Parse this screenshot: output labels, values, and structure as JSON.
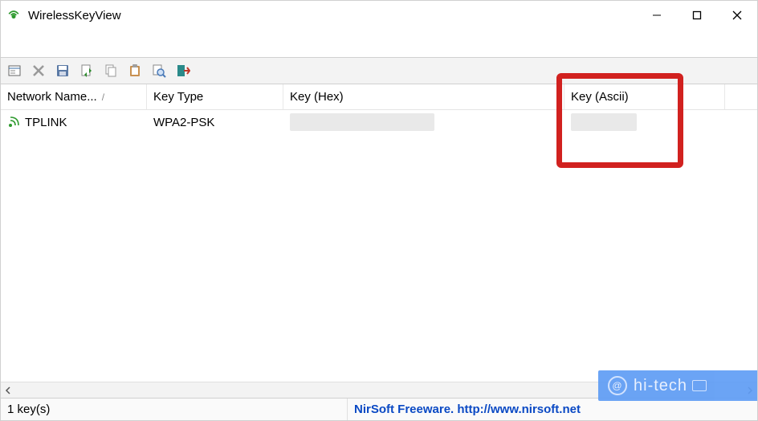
{
  "window": {
    "title": "WirelessKeyView"
  },
  "columns": {
    "c0": "Network Name...",
    "c1": "Key Type",
    "c2": "Key (Hex)",
    "c3": "Key (Ascii)",
    "sort_indicator": "/"
  },
  "rows": [
    {
      "name": "TPLINK",
      "keytype": "WPA2-PSK",
      "hex": "",
      "ascii": ""
    }
  ],
  "status": {
    "count_text": "1 key(s)",
    "credit": "NirSoft Freeware.  http://www.nirsoft.net"
  },
  "watermark": {
    "label": "hi-tech"
  },
  "toolbar_icons": [
    "properties-icon",
    "delete-icon",
    "save-icon",
    "refresh-icon",
    "copy-icon",
    "paste-icon",
    "find-icon",
    "exit-icon"
  ]
}
